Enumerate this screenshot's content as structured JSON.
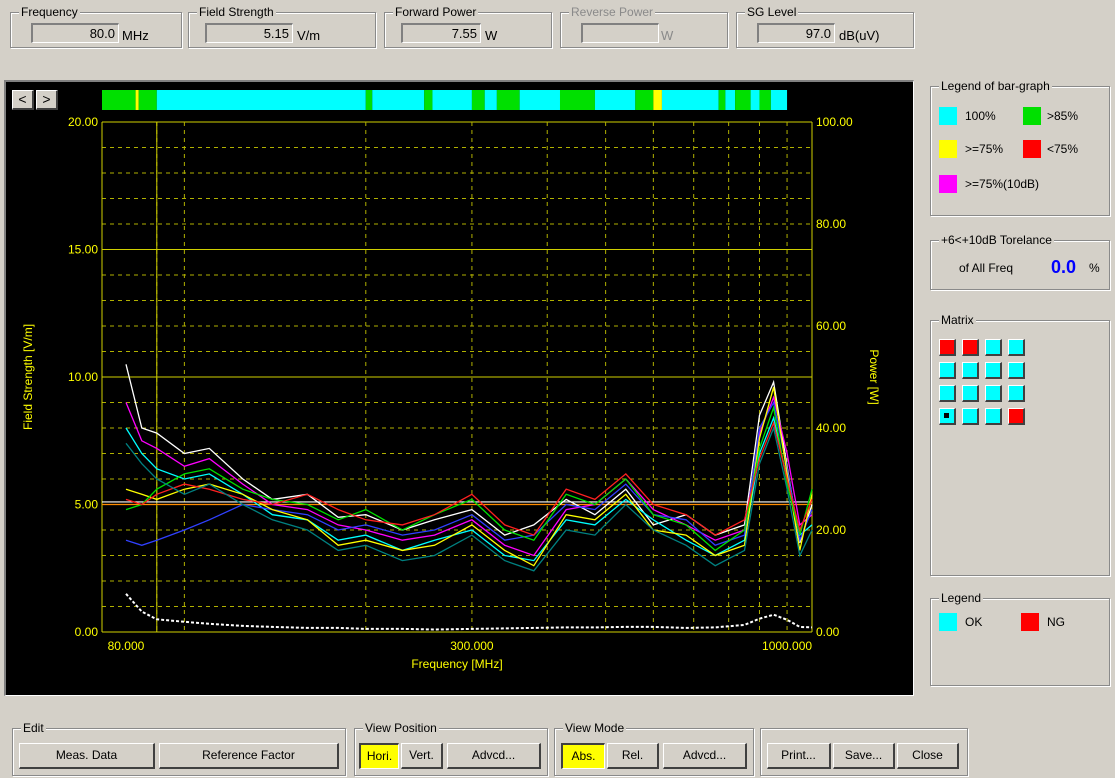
{
  "readouts": {
    "frequency": {
      "caption": "Frequency",
      "value": "80.0",
      "unit": "MHz"
    },
    "field_strength": {
      "caption": "Field Strength",
      "value": "5.15",
      "unit": "V/m"
    },
    "forward_power": {
      "caption": "Forward Power",
      "value": "7.55",
      "unit": "W"
    },
    "reverse_power": {
      "caption": "Reverse Power",
      "value": "",
      "unit": "W"
    },
    "sg_level": {
      "caption": "SG Level",
      "value": "97.0",
      "unit": "dB(uV)"
    }
  },
  "nav": {
    "prev": "<",
    "next": ">"
  },
  "legend_bar": {
    "caption": "Legend of bar-graph",
    "items": [
      {
        "label": "100%",
        "color": "#00ffff"
      },
      {
        "label": ">85%",
        "color": "#00e000"
      },
      {
        "label": ">=75%",
        "color": "#ffff00"
      },
      {
        "label": "<75%",
        "color": "#ff0000"
      },
      {
        "label": ">=75%(10dB)",
        "color": "#ff00ff"
      }
    ]
  },
  "tolerance": {
    "caption": "+6<+10dB Torelance",
    "label": "of All Freq",
    "value": "0.0",
    "unit": "%"
  },
  "matrix": {
    "caption": "Matrix",
    "cells": [
      [
        "#ff0000",
        "#ff0000",
        "#00ffff",
        "#00ffff"
      ],
      [
        "#00ffff",
        "#00ffff",
        "#00ffff",
        "#00ffff"
      ],
      [
        "#00ffff",
        "#00ffff",
        "#00ffff",
        "#00ffff"
      ],
      [
        "#00ffff",
        "#00ffff",
        "#00ffff",
        "#ff0000"
      ]
    ],
    "selected": [
      3,
      0
    ]
  },
  "legend": {
    "caption": "Legend",
    "ok": "OK",
    "ng": "NG",
    "ok_color": "#00ffff",
    "ng_color": "#ff0000"
  },
  "edit": {
    "caption": "Edit",
    "meas_data": "Meas. Data",
    "reference_factor": "Reference Factor"
  },
  "view_position": {
    "caption": "View Position",
    "hori": "Hori.",
    "vert": "Vert.",
    "advcd": "Advcd...",
    "active": "hori"
  },
  "view_mode": {
    "caption": "View Mode",
    "abs": "Abs.",
    "rel": "Rel.",
    "advcd": "Advcd...",
    "active": "abs"
  },
  "actions": {
    "print": "Print...",
    "save": "Save...",
    "close": "Close"
  },
  "chart_data": {
    "type": "line",
    "xlabel": "Frequency [MHz]",
    "ylabel": "Field Strength [V/m]",
    "y2label": "Power [W]",
    "x_scale": "log",
    "xlim": [
      73,
      1100
    ],
    "x_ticks": [
      {
        "value": 80,
        "label": "80.000"
      },
      {
        "value": 300,
        "label": "300.000"
      },
      {
        "value": 1000,
        "label": "1000.000"
      }
    ],
    "ylim": [
      0,
      20
    ],
    "y_ticks": [
      "0.00",
      "5.00",
      "10.00",
      "15.00",
      "20.00"
    ],
    "y2lim": [
      0,
      100
    ],
    "y2_ticks": [
      "0.00",
      "20.00",
      "40.00",
      "60.00",
      "80.00",
      "100.00"
    ],
    "reference_lines": [
      {
        "y": 5.0,
        "color": "#ff8c00"
      },
      {
        "y": 5.1,
        "color": "#ffffff"
      }
    ],
    "x": [
      80,
      85,
      90,
      100,
      110,
      125,
      140,
      160,
      180,
      200,
      230,
      260,
      300,
      340,
      380,
      430,
      480,
      540,
      600,
      680,
      760,
      850,
      900,
      950,
      1000,
      1050,
      1100
    ],
    "series": [
      {
        "color": "#ffffff",
        "values": [
          10.5,
          8.0,
          7.8,
          7.0,
          7.2,
          6.0,
          5.2,
          5.4,
          4.5,
          4.6,
          4.0,
          4.4,
          4.8,
          3.8,
          4.2,
          5.2,
          4.6,
          5.6,
          4.2,
          4.6,
          3.8,
          4.2,
          8.5,
          9.8,
          6.5,
          3.5,
          5.0
        ]
      },
      {
        "color": "#ff00ff",
        "values": [
          9.0,
          7.5,
          7.2,
          6.5,
          6.8,
          5.8,
          5.0,
          4.8,
          4.2,
          4.0,
          3.6,
          3.8,
          4.4,
          3.4,
          3.0,
          4.8,
          5.0,
          6.0,
          4.8,
          4.2,
          3.6,
          4.0,
          7.8,
          9.2,
          7.0,
          4.2,
          4.6
        ]
      },
      {
        "color": "#00ffff",
        "values": [
          8.0,
          7.0,
          6.4,
          6.0,
          6.2,
          5.4,
          4.6,
          4.4,
          3.6,
          3.8,
          3.2,
          3.6,
          4.0,
          3.0,
          2.8,
          4.4,
          4.2,
          5.2,
          4.4,
          3.6,
          3.0,
          3.6,
          7.0,
          8.4,
          6.0,
          3.8,
          4.2
        ]
      },
      {
        "color": "#3040ff",
        "values": [
          3.6,
          3.4,
          3.6,
          4.0,
          4.4,
          5.0,
          4.8,
          4.6,
          4.0,
          4.2,
          3.8,
          4.0,
          4.6,
          3.6,
          3.8,
          5.0,
          4.8,
          5.8,
          4.6,
          4.4,
          3.4,
          3.8,
          8.0,
          9.0,
          6.4,
          3.6,
          4.8
        ]
      },
      {
        "color": "#ffff00",
        "values": [
          5.6,
          5.4,
          5.2,
          5.6,
          5.8,
          5.4,
          4.8,
          4.4,
          3.4,
          3.6,
          3.2,
          3.4,
          4.2,
          3.2,
          2.6,
          4.6,
          4.4,
          5.4,
          4.0,
          3.8,
          3.0,
          3.4,
          7.6,
          9.6,
          6.2,
          3.2,
          5.4
        ]
      },
      {
        "color": "#00e000",
        "values": [
          4.8,
          5.0,
          5.6,
          6.2,
          6.4,
          5.6,
          5.2,
          5.0,
          4.4,
          4.8,
          4.0,
          4.6,
          5.2,
          4.0,
          3.6,
          5.4,
          5.0,
          6.0,
          4.6,
          4.2,
          3.2,
          4.0,
          7.2,
          8.8,
          5.8,
          3.8,
          5.6
        ]
      },
      {
        "color": "#ff2020",
        "values": [
          5.2,
          5.0,
          5.4,
          5.8,
          5.6,
          5.2,
          5.0,
          5.4,
          4.8,
          4.4,
          4.2,
          4.6,
          5.4,
          4.2,
          3.8,
          5.6,
          5.2,
          6.2,
          5.0,
          4.6,
          3.8,
          4.4,
          6.8,
          8.2,
          6.0,
          4.0,
          5.2
        ]
      },
      {
        "color": "#008080",
        "values": [
          7.4,
          6.6,
          6.0,
          5.4,
          5.8,
          5.0,
          4.4,
          4.0,
          3.2,
          3.4,
          2.8,
          3.0,
          3.8,
          2.8,
          2.4,
          4.0,
          3.8,
          5.0,
          4.0,
          3.4,
          2.6,
          3.2,
          6.6,
          8.0,
          5.6,
          3.0,
          4.0
        ]
      }
    ],
    "power_series": {
      "color": "#ffffff",
      "values": [
        7.5,
        4.0,
        2.5,
        2.0,
        1.6,
        1.2,
        1.0,
        0.8,
        0.8,
        0.6,
        0.6,
        0.5,
        0.6,
        0.7,
        0.8,
        0.9,
        0.9,
        1.0,
        1.0,
        0.8,
        0.9,
        1.4,
        2.6,
        3.4,
        2.4,
        1.0,
        0.9
      ]
    },
    "bar_segments": [
      {
        "to": 83,
        "color": "#00e000"
      },
      {
        "to": 84,
        "color": "#ffff00"
      },
      {
        "to": 90,
        "color": "#00e000"
      },
      {
        "to": 200,
        "color": "#00ffff"
      },
      {
        "to": 205,
        "color": "#00e000"
      },
      {
        "to": 250,
        "color": "#00ffff"
      },
      {
        "to": 258,
        "color": "#00e000"
      },
      {
        "to": 300,
        "color": "#00ffff"
      },
      {
        "to": 315,
        "color": "#00e000"
      },
      {
        "to": 330,
        "color": "#00ffff"
      },
      {
        "to": 360,
        "color": "#00e000"
      },
      {
        "to": 420,
        "color": "#00ffff"
      },
      {
        "to": 480,
        "color": "#00e000"
      },
      {
        "to": 560,
        "color": "#00ffff"
      },
      {
        "to": 600,
        "color": "#00e000"
      },
      {
        "to": 620,
        "color": "#ffff00"
      },
      {
        "to": 770,
        "color": "#00ffff"
      },
      {
        "to": 790,
        "color": "#00e000"
      },
      {
        "to": 820,
        "color": "#00ffff"
      },
      {
        "to": 870,
        "color": "#00e000"
      },
      {
        "to": 900,
        "color": "#00ffff"
      },
      {
        "to": 940,
        "color": "#00e000"
      },
      {
        "to": 1000,
        "color": "#00ffff"
      }
    ]
  }
}
